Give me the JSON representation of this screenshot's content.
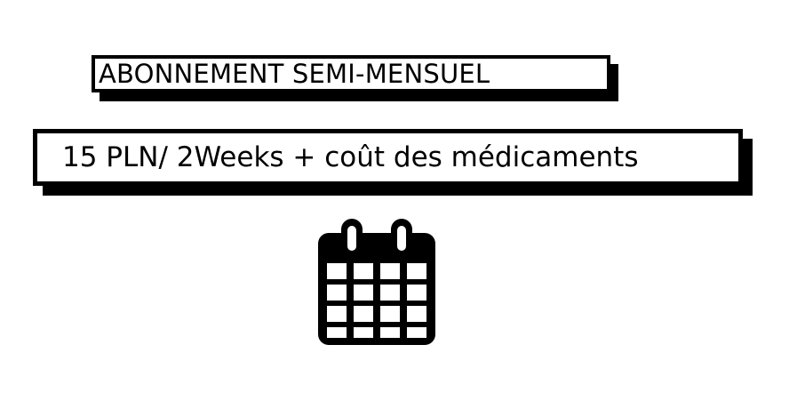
{
  "subscription": {
    "title": "ABONNEMENT SEMI-MENSUEL",
    "price_line": "15 PLN/ 2Weeks + coût des médicaments"
  },
  "icons": {
    "calendar": "calendar-icon"
  },
  "colors": {
    "ink": "#000000",
    "background": "#ffffff"
  }
}
